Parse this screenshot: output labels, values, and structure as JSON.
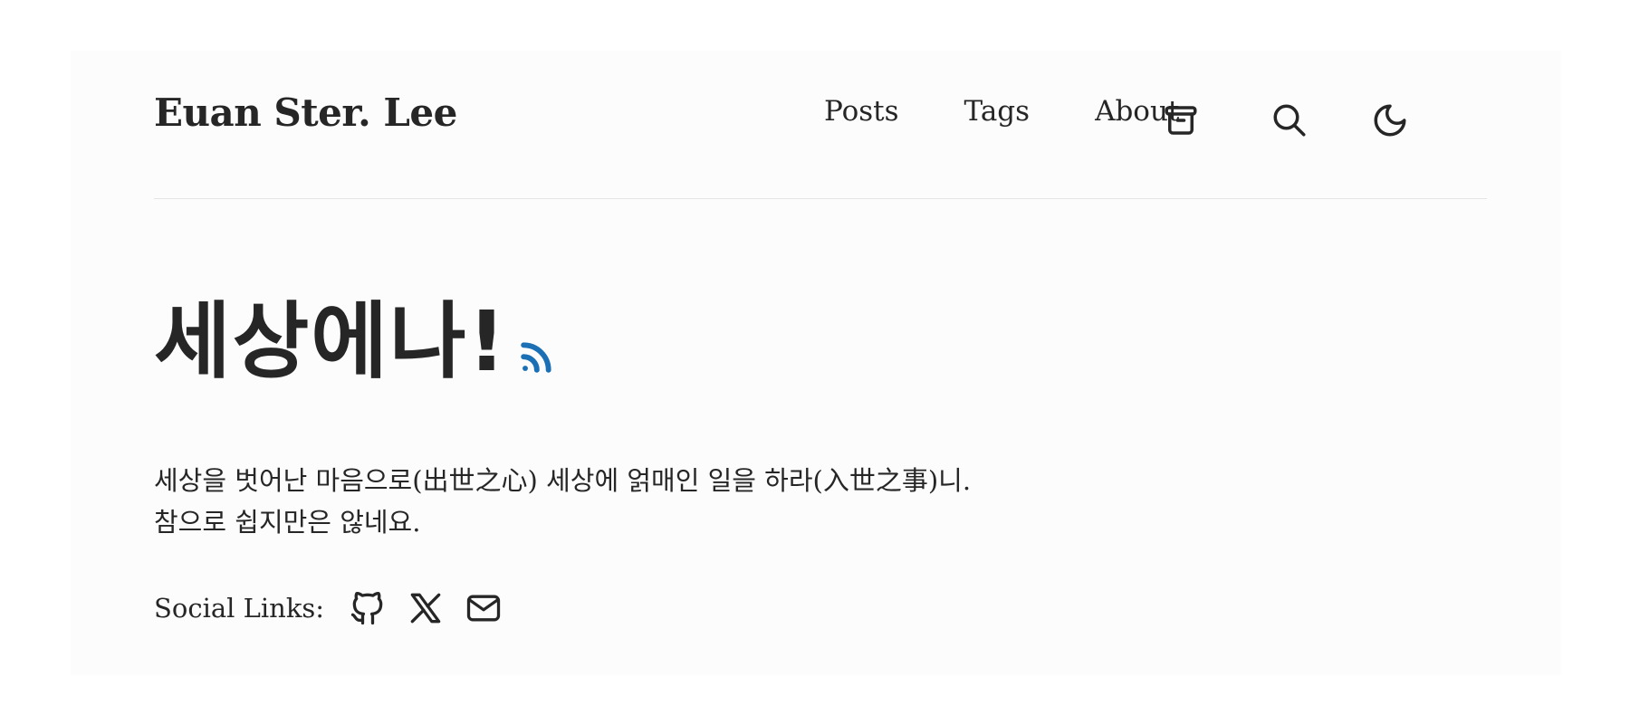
{
  "header": {
    "site_title": "Euan Ster. Lee",
    "nav": {
      "posts_label": "Posts",
      "tags_label": "Tags",
      "about_label": "About"
    },
    "icons": [
      "archive-icon",
      "search-icon",
      "moon-icon"
    ]
  },
  "hero": {
    "title": "세상에나!",
    "rss_icon": "rss-icon",
    "rss_color": "#1a6fb5"
  },
  "bio": {
    "line1": "세상을 벗어난 마음으로(出世之心) 세상에 얽매인 일을 하라(入世之事)니.",
    "line2": "참으로 쉽지만은 않네요."
  },
  "social": {
    "label": "Social Links:",
    "icons": [
      "github-icon",
      "x-icon",
      "mail-icon"
    ]
  },
  "colors": {
    "text": "#262626",
    "background": "#fcfcfc",
    "divider": "#e4e4e4",
    "accent": "#1a6fb5"
  }
}
